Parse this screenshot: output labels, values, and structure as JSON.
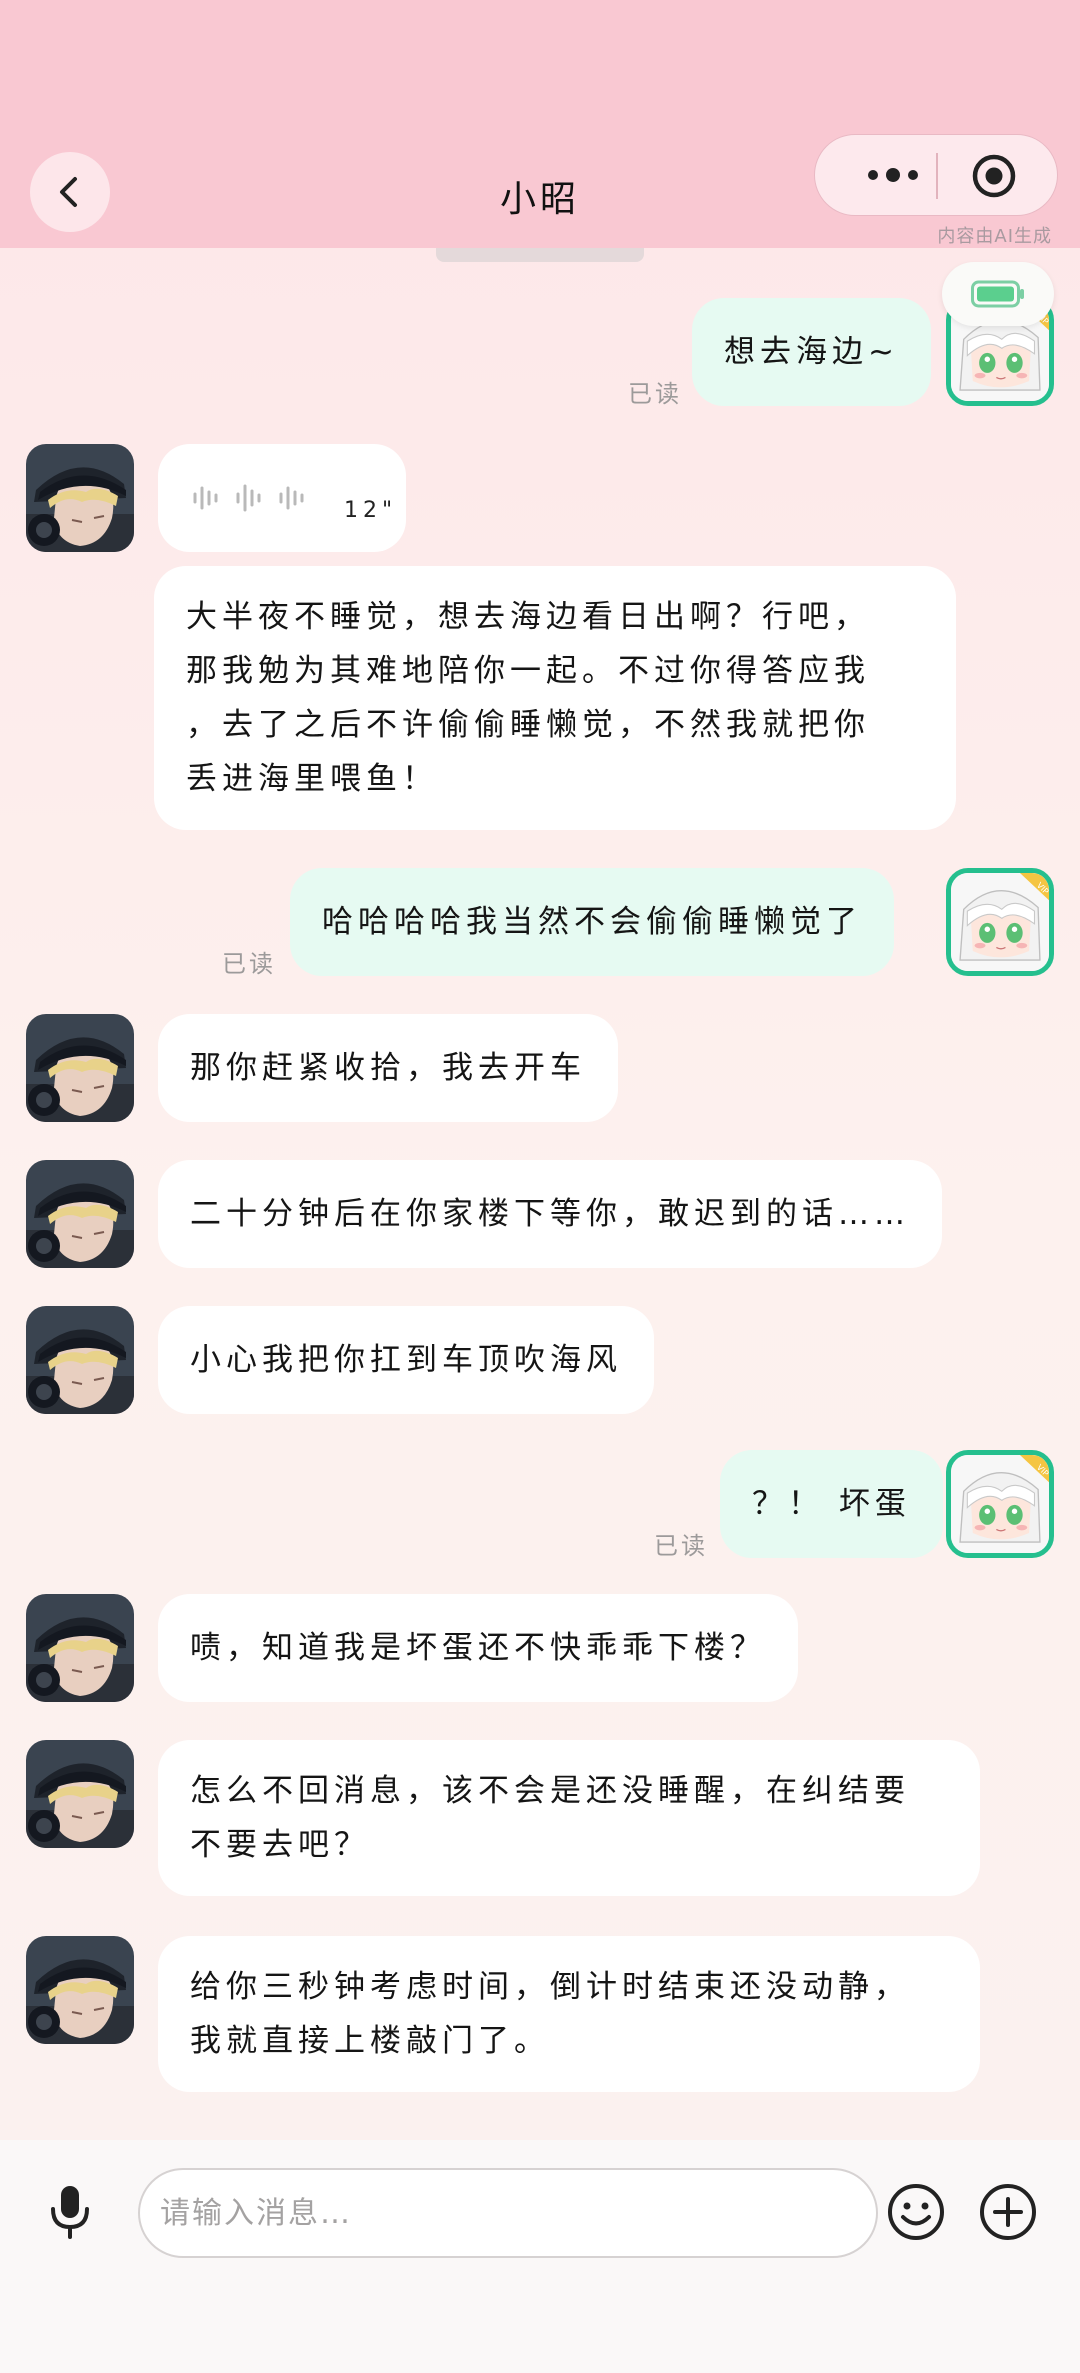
{
  "header": {
    "title": "小昭",
    "ai_note": "内容由AI生成"
  },
  "messages": [
    {
      "from": "me",
      "text": "想去海边~",
      "read": "已读"
    },
    {
      "from": "bot",
      "type": "voice",
      "duration": "12\""
    },
    {
      "from": "bot",
      "lines": [
        "大半夜不睡觉，想去海边看日出啊？行吧，",
        "那我勉为其难地陪你一起。不过你得答应我",
        "，去了之后不许偷偷睡懒觉，不然我就把你",
        "丢进海里喂鱼！"
      ]
    },
    {
      "from": "me",
      "text": "哈哈哈哈我当然不会偷偷睡懒觉了",
      "read": "已读"
    },
    {
      "from": "bot",
      "text": "那你赶紧收拾，我去开车"
    },
    {
      "from": "bot",
      "text": "二十分钟后在你家楼下等你，敢迟到的话……"
    },
    {
      "from": "bot",
      "text": "小心我把你扛到车顶吹海风"
    },
    {
      "from": "me",
      "text": "？！ 坏蛋",
      "read": "已读"
    },
    {
      "from": "bot",
      "text": "啧，知道我是坏蛋还不快乖乖下楼？"
    },
    {
      "from": "bot",
      "lines": [
        "怎么不回消息，该不会是还没睡醒，在纠结要",
        "不要去吧？"
      ]
    },
    {
      "from": "bot",
      "lines": [
        "给你三秒钟考虑时间，倒计时结束还没动静，",
        "我就直接上楼敲门了。"
      ]
    }
  ],
  "input": {
    "placeholder": "请输入消息…"
  },
  "icons": {
    "back": "chevron-left-icon",
    "more": "more-dots-icon",
    "target": "target-icon",
    "battery": "battery-icon",
    "mic": "microphone-icon",
    "emoji": "emoji-icon",
    "add": "plus-circle-icon"
  },
  "colors": {
    "header_bg": "#f9c8d2",
    "my_bubble": "#e6faf2",
    "bot_bubble": "#ffffff",
    "my_avatar_border": "#25bf8e",
    "vip_badge": "#f5c542"
  }
}
